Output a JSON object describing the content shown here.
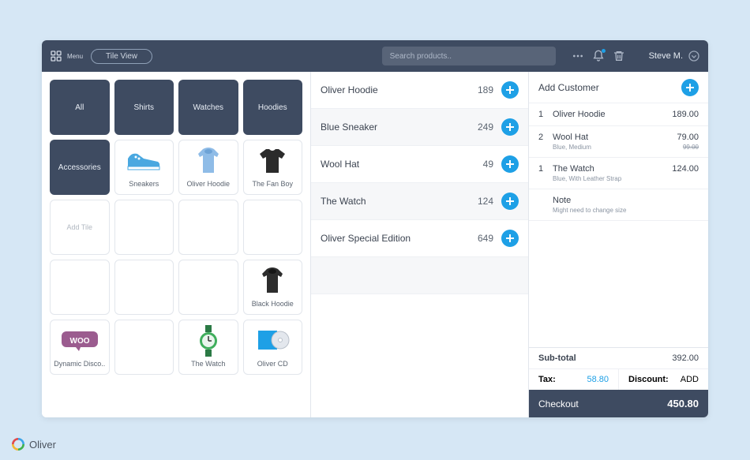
{
  "topbar": {
    "menu_label": "Menu",
    "tile_view_label": "Tile View",
    "search_placeholder": "Search products..",
    "user_name": "Steve M."
  },
  "categories": [
    "All",
    "Shirts",
    "Watches",
    "Hoodies",
    "Accessories"
  ],
  "tiles": [
    {
      "label": "Sneakers",
      "icon": "sneaker"
    },
    {
      "label": "Oliver Hoodie",
      "icon": "hoodie-blue"
    },
    {
      "label": "The Fan Boy",
      "icon": "tshirt-black"
    }
  ],
  "add_tile_label": "Add Tile",
  "tiles_row4": [
    {
      "label": "",
      "icon": ""
    },
    {
      "label": "",
      "icon": ""
    },
    {
      "label": "",
      "icon": ""
    },
    {
      "label": "Black Hoodie",
      "icon": "hoodie-black"
    }
  ],
  "tiles_row5": [
    {
      "label": "Dynamic Disco..",
      "icon": "woo"
    },
    {
      "label": "",
      "icon": ""
    },
    {
      "label": "The Watch",
      "icon": "watch"
    },
    {
      "label": "Oliver CD",
      "icon": "cd"
    }
  ],
  "products": [
    {
      "name": "Oliver Hoodie",
      "price": "189"
    },
    {
      "name": "Blue Sneaker",
      "price": "249"
    },
    {
      "name": "Wool Hat",
      "price": "49"
    },
    {
      "name": "The Watch",
      "price": "124"
    },
    {
      "name": "Oliver Special Edition",
      "price": "649"
    }
  ],
  "cart": {
    "add_customer_label": "Add Customer",
    "items": [
      {
        "qty": "1",
        "name": "Oliver Hoodie",
        "variant": "",
        "price": "189.00",
        "strike": ""
      },
      {
        "qty": "2",
        "name": "Wool Hat",
        "variant": "Blue, Medium",
        "price": "79.00",
        "strike": "99.00"
      },
      {
        "qty": "1",
        "name": "The Watch",
        "variant": "Blue, With Leather Strap",
        "price": "124.00",
        "strike": ""
      }
    ],
    "note_title": "Note",
    "note_text": "Might need to change size",
    "subtotal_label": "Sub-total",
    "subtotal_value": "392.00",
    "tax_label": "Tax:",
    "tax_value": "58.80",
    "discount_label": "Discount:",
    "discount_action": "ADD",
    "checkout_label": "Checkout",
    "checkout_total": "450.80"
  },
  "brand": {
    "name": "Oliver"
  }
}
